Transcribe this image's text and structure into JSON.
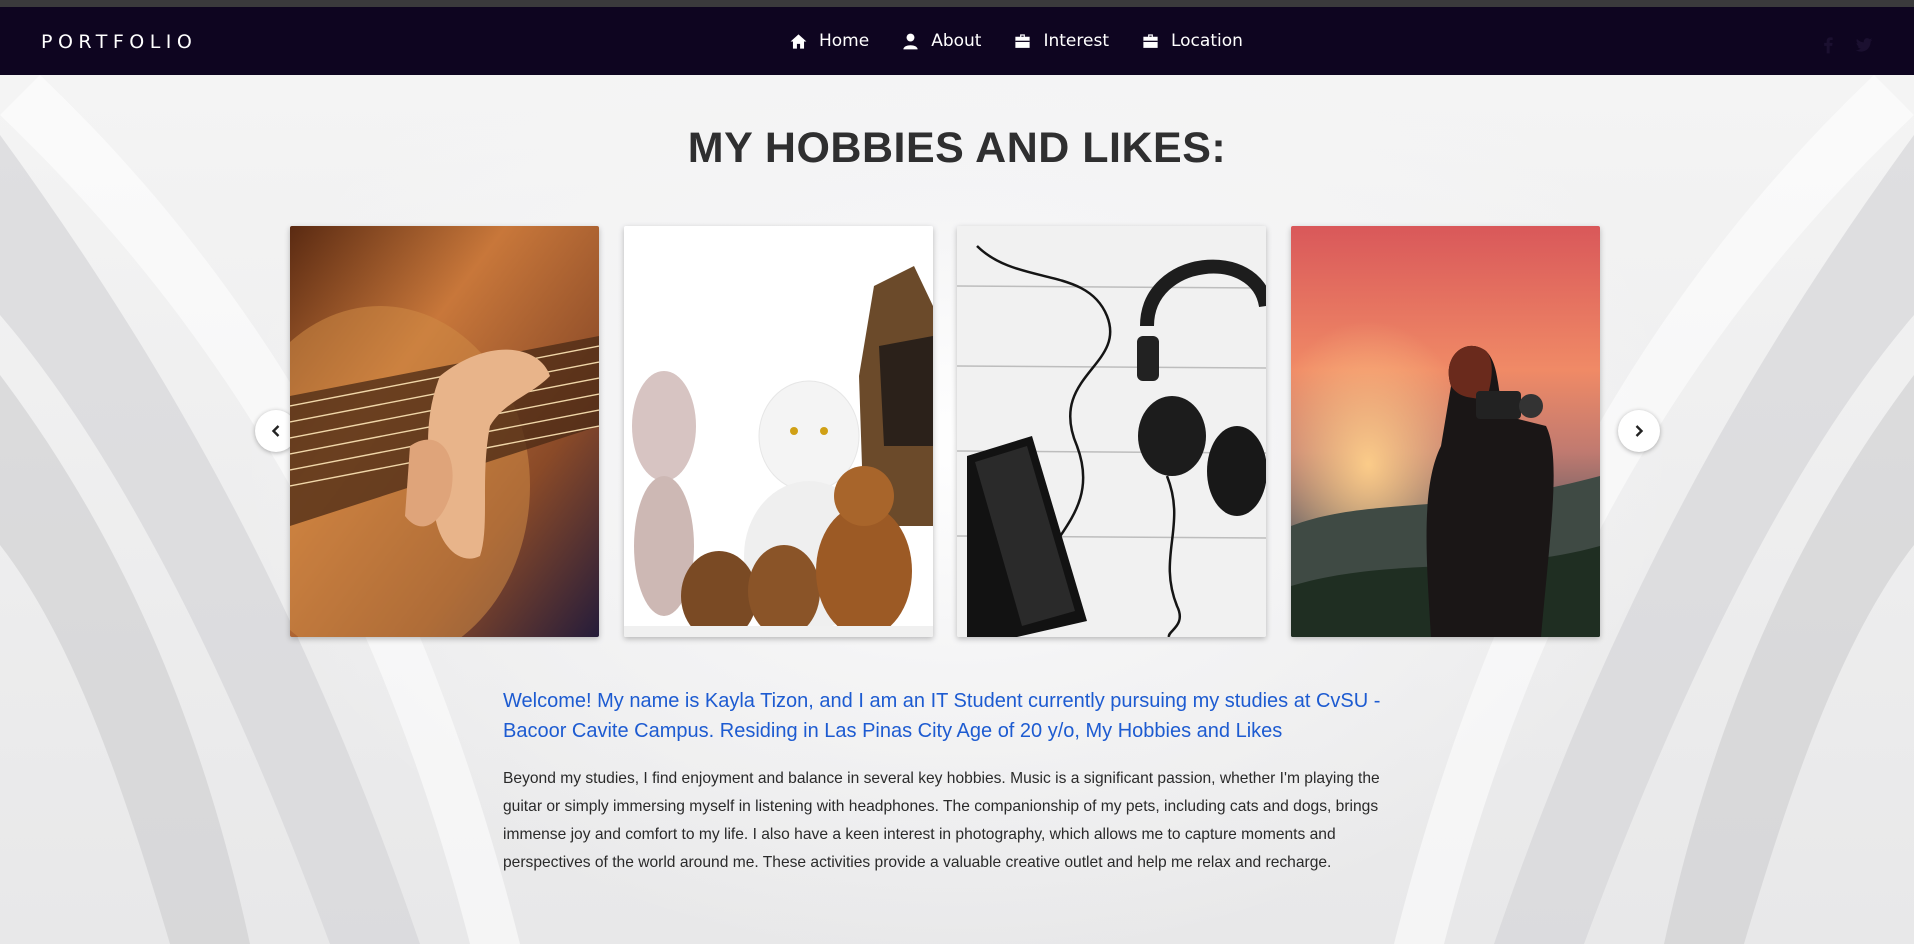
{
  "brand": "PORTFOLIO",
  "nav": [
    {
      "label": "Home",
      "icon": "home-icon"
    },
    {
      "label": "About",
      "icon": "user-icon"
    },
    {
      "label": "Interest",
      "icon": "briefcase-icon"
    },
    {
      "label": "Location",
      "icon": "briefcase-icon"
    }
  ],
  "socials": [
    "facebook-icon",
    "twitter-icon"
  ],
  "page_title": "MY HOBBIES AND LIKES:",
  "carousel": {
    "images": [
      "guitar-image",
      "pets-image",
      "headphones-image",
      "photography-image"
    ],
    "prev_icon": "chevron-left-icon",
    "next_icon": "chevron-right-icon"
  },
  "intro": "Welcome! My name is Kayla Tizon, and I am an IT Student currently pursuing my studies at CvSU - Bacoor Cavite Campus. Residing in Las Pinas City Age of 20 y/o, My Hobbies and Likes",
  "description": "Beyond my studies, I find enjoyment and balance in several key hobbies. Music is a significant passion, whether I'm playing the guitar or simply immersing myself in listening with headphones. The companionship of my pets, including cats and dogs, brings immense joy and comfort to my life. I also have a keen interest in photography, which allows me to capture moments and perspectives of the world around me. These activities provide a valuable creative outlet and help me relax and recharge.",
  "colors": {
    "navbar": "#0e0520",
    "intro_text": "#1d5bd1",
    "title": "#2f2f30"
  }
}
